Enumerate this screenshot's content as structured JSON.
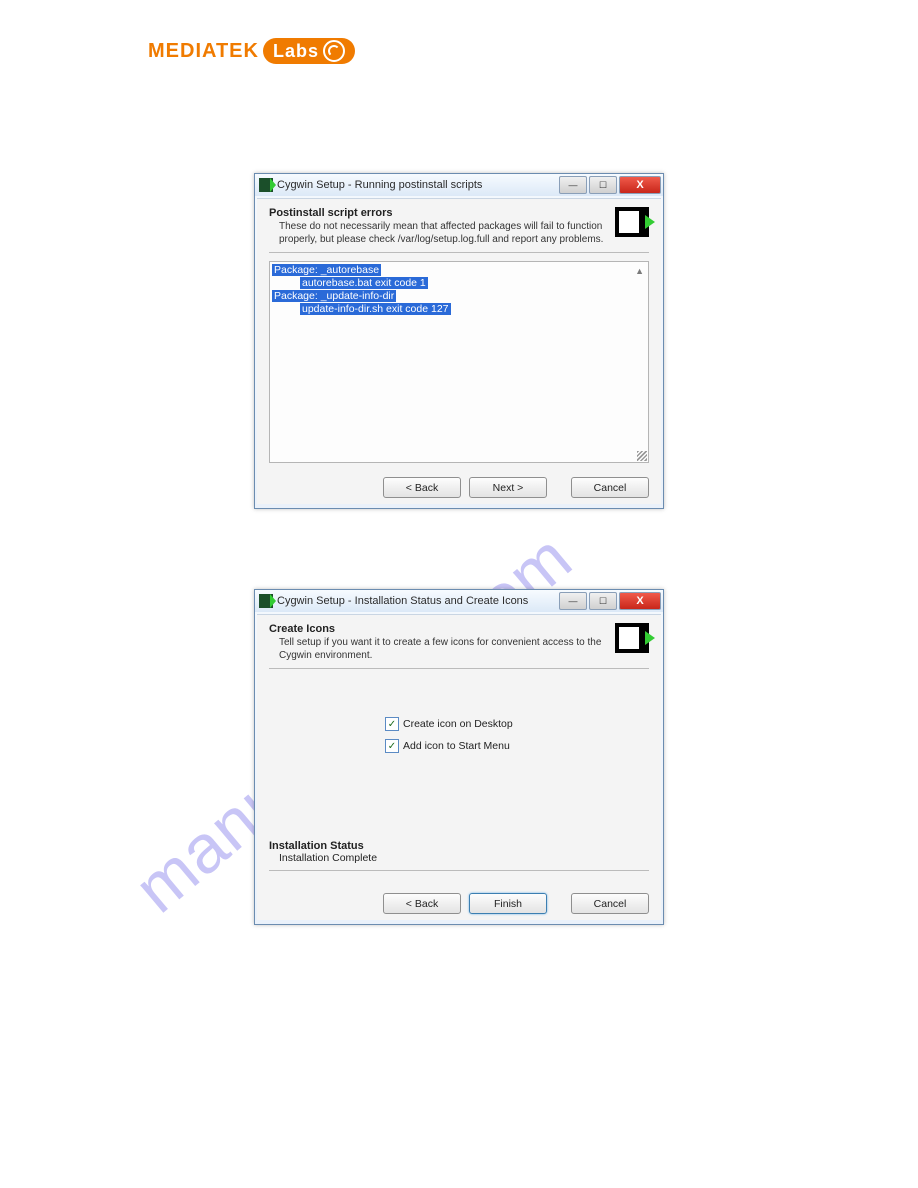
{
  "logo": {
    "brand": "MEDIATEK",
    "labs": "Labs"
  },
  "watermark": "manualshive.com",
  "window1": {
    "title": "Cygwin Setup - Running postinstall scripts",
    "header": {
      "title": "Postinstall script errors",
      "desc": "These do not necessarily mean that affected packages will fail to function properly, but please check /var/log/setup.log.full and report any problems."
    },
    "log": {
      "line1": "Package: _autorebase",
      "line2": "autorebase.bat exit code 1",
      "line3": "Package: _update-info-dir",
      "line4": "update-info-dir.sh exit code 127"
    },
    "buttons": {
      "back": "< Back",
      "next": "Next >",
      "cancel": "Cancel"
    }
  },
  "window2": {
    "title": "Cygwin Setup - Installation Status and Create Icons",
    "header": {
      "title": "Create Icons",
      "desc": "Tell setup if you want it to create a few icons for convenient access to the Cygwin environment."
    },
    "options": {
      "opt1": "Create icon on Desktop",
      "opt2": "Add icon to Start Menu"
    },
    "status": {
      "title": "Installation Status",
      "text": "Installation Complete"
    },
    "buttons": {
      "back": "< Back",
      "finish": "Finish",
      "cancel": "Cancel"
    }
  }
}
